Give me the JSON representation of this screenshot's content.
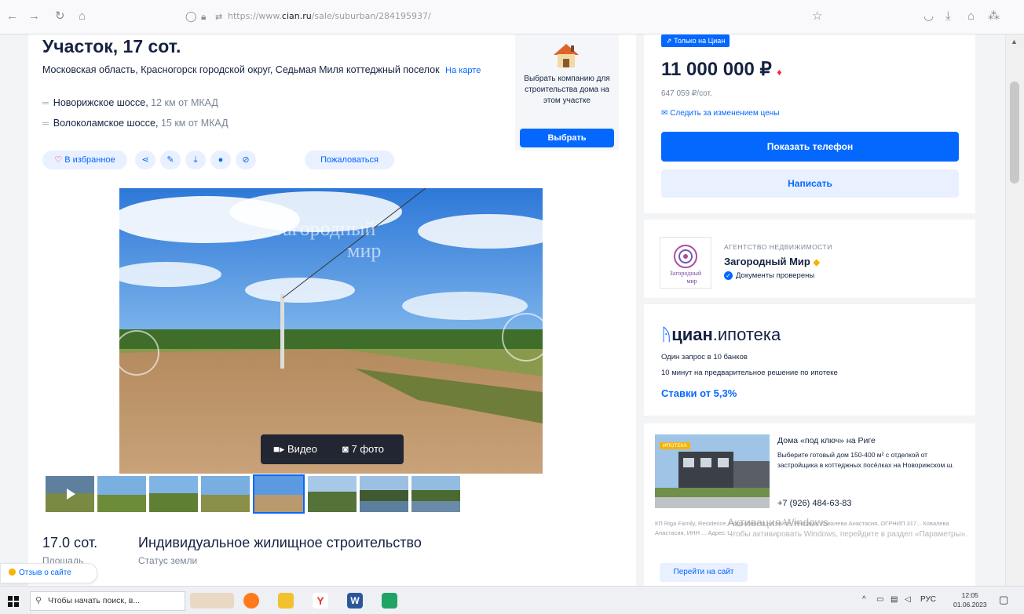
{
  "browser": {
    "url_prefix": "https://www.",
    "url_domain": "cian.ru",
    "url_path": "/sale/suburban/284195937/"
  },
  "listing": {
    "title": "Участок, 17 сот.",
    "address": "Московская область, Красногорск городской округ, Седьмая Миля коттеджный поселок",
    "map_link": "На карте",
    "highways": [
      {
        "name": "Новорижское шоссе,",
        "distance": "12 км от МКАД"
      },
      {
        "name": "Волоколамское шоссе,",
        "distance": "15 км от МКАД"
      }
    ],
    "actions": {
      "favorite": "В избранное",
      "complain": "Пожаловаться"
    },
    "build_box": {
      "text": "Выбрать компанию для строительства дома на этом участке",
      "button": "Выбрать"
    },
    "media": {
      "video": "Видео",
      "photos": "7 фото"
    },
    "stats": [
      {
        "value": "17.0 сот.",
        "label": "Площадь"
      },
      {
        "value": "Индивидуальное жилищное строительство",
        "label": "Статус земли"
      }
    ]
  },
  "sidebar": {
    "badge": "Только на Циан",
    "price": "11 000 000 ₽",
    "price_per_unit": "647 059 ₽/сот.",
    "watch_price": "Следить за изменением цены",
    "show_phone": "Показать телефон",
    "write": "Написать",
    "agency": {
      "type": "АГЕНТСТВО НЕДВИЖИМОСТИ",
      "name": "Загородный Мир",
      "docs": "Документы проверены",
      "logo_text_1": "Загородный",
      "logo_text_2": "мир"
    },
    "ipoteka": {
      "brand": "циан",
      "suffix": ".ипотека",
      "line1": "Один запрос в 10 банков",
      "line2": "10 минут на предварительное решение по ипотеке",
      "rate": "Ставки от 5,3%"
    },
    "ad": {
      "tag": "ИПОТЕКА",
      "title": "Дома «под ключ» на Риге",
      "desc": "Выберите готовый дом 150-400 м² с отделкой от застройщика в коттеджных посёлках на Новорижском ш.",
      "phone": "+7 (926) 484-63-83",
      "legal": "КП Riga Family, Residence. Подробности на сайте. Реклама: Ковалева Анастасия, ОГРНИП 317... Ковалева Анастасия, ИНН ... Адрес: ...",
      "link": "Перейти на сайт"
    }
  },
  "overlay": {
    "activate_title": "Активация Windows",
    "activate_sub": "Чтобы активировать Windows, перейдите в раздел «Параметры»."
  },
  "feedback": "Отзыв о сайте",
  "taskbar": {
    "search_placeholder": "Чтобы начать поиск, в...",
    "lang": "РУС",
    "time": "12:05",
    "date": "01.06.2023"
  },
  "photo_watermark": [
    "Загородный",
    "мир"
  ],
  "colors": {
    "accent": "#0468ff",
    "price_down": "#ff1f34",
    "badge_gold": "#f4b400",
    "text": "#152242"
  }
}
